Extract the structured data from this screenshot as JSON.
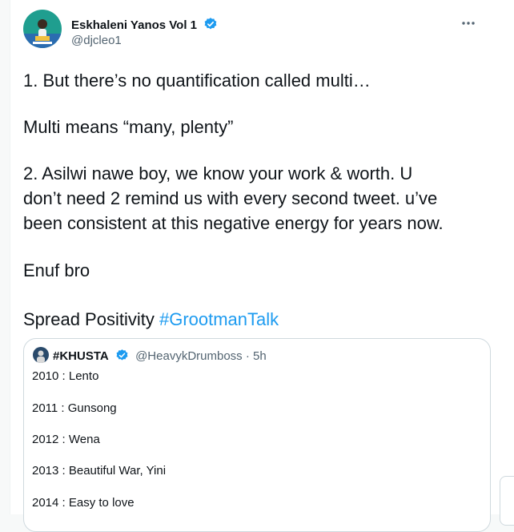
{
  "author": {
    "display_name": "Eskhaleni Yanos Vol 1",
    "handle": "@djcleo1",
    "verified": true,
    "avatar_icon": "profile-photo"
  },
  "tweet": {
    "line1": "1. But there’s no quantification called multi…",
    "line2": "Multi means “many, plenty”",
    "line3": "2. Asilwi nawe boy, we know your work & worth. U",
    "line4": "don’t need 2 remind us with every second tweet. u’ve",
    "line5": "been consistent at this negative energy for years now.",
    "line6": "Enuf bro",
    "line7_text": "Spread Positivity ",
    "hashtag": "#GrootmanTalk"
  },
  "quoted": {
    "display_name": "#KHUSTA",
    "verified": true,
    "meta": "@HeavykDrumboss · 5h",
    "lines": [
      "2010 : Lento",
      "2011 : Gunsong",
      "2012 : Wena",
      "2013 : Beautiful War, Yini",
      "2014 : Easy to love"
    ]
  },
  "colors": {
    "link": "#1d9bf0",
    "secondary_text": "#536471",
    "verified": "#1d9bf0",
    "border": "#cfd9de"
  }
}
